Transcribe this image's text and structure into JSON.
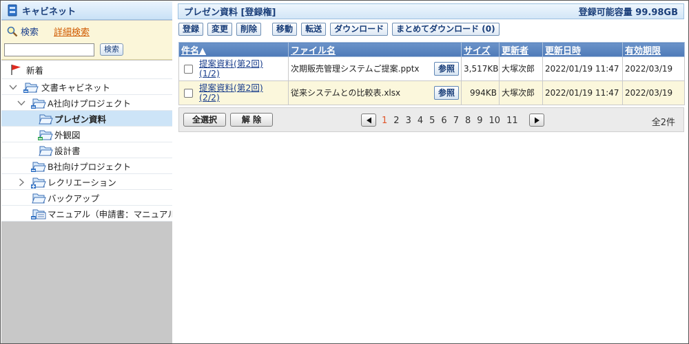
{
  "cabinet": {
    "title": "キャビネット"
  },
  "search": {
    "search_label": "検索",
    "advanced_label": "詳細検索",
    "input_value": "",
    "button_label": "検索"
  },
  "tree": {
    "new_label": "新着",
    "items": [
      {
        "label": "文書キャビネット"
      },
      {
        "label": "A社向けプロジェクト"
      },
      {
        "label": "プレゼン資料"
      },
      {
        "label": "外観図"
      },
      {
        "label": "設計書"
      },
      {
        "label": "B社向けプロジェクト"
      },
      {
        "label": "レクリエーション"
      },
      {
        "label": "バックアップ"
      },
      {
        "label": "マニュアル（申請書：マニュアル登録"
      }
    ]
  },
  "header": {
    "title": "プレゼン資料 [登録権]",
    "capacity": "登録可能容量 99.98GB"
  },
  "toolbar": {
    "register": "登録",
    "change": "変更",
    "delete": "削除",
    "move": "移動",
    "transfer": "転送",
    "download": "ダウンロード",
    "bulk_download": "まとめてダウンロード (0)"
  },
  "table": {
    "columns": {
      "subject": "件名▲",
      "filename": "ファイル名",
      "size": "サイズ",
      "updater": "更新者",
      "updated": "更新日時",
      "expiry": "有効期限"
    },
    "ref_label": "参照",
    "rows": [
      {
        "subject_line1": "提案資料(第2回)",
        "subject_line2": "(1/2)",
        "filename": "次期販売管理システムご提案.pptx",
        "size": "3,517KB",
        "updater": "大塚次郎",
        "updated": "2022/01/19 11:47",
        "expiry": "2022/03/19"
      },
      {
        "subject_line1": "提案資料(第2回)",
        "subject_line2": "(2/2)",
        "filename": "従来システムとの比較表.xlsx",
        "size": "994KB",
        "updater": "大塚次郎",
        "updated": "2022/01/19 11:47",
        "expiry": "2022/03/19"
      }
    ]
  },
  "pager": {
    "select_all": "全選択",
    "clear": "解 除",
    "pages": [
      "1",
      "2",
      "3",
      "4",
      "5",
      "6",
      "7",
      "8",
      "9",
      "10",
      "11"
    ],
    "current_page": "1",
    "total": "全2件"
  },
  "colors": {
    "accent": "#4e7ab8",
    "current_page": "#e0552a",
    "selected_row": "#cde4f7",
    "highlight_row": "#fbf7dc"
  }
}
